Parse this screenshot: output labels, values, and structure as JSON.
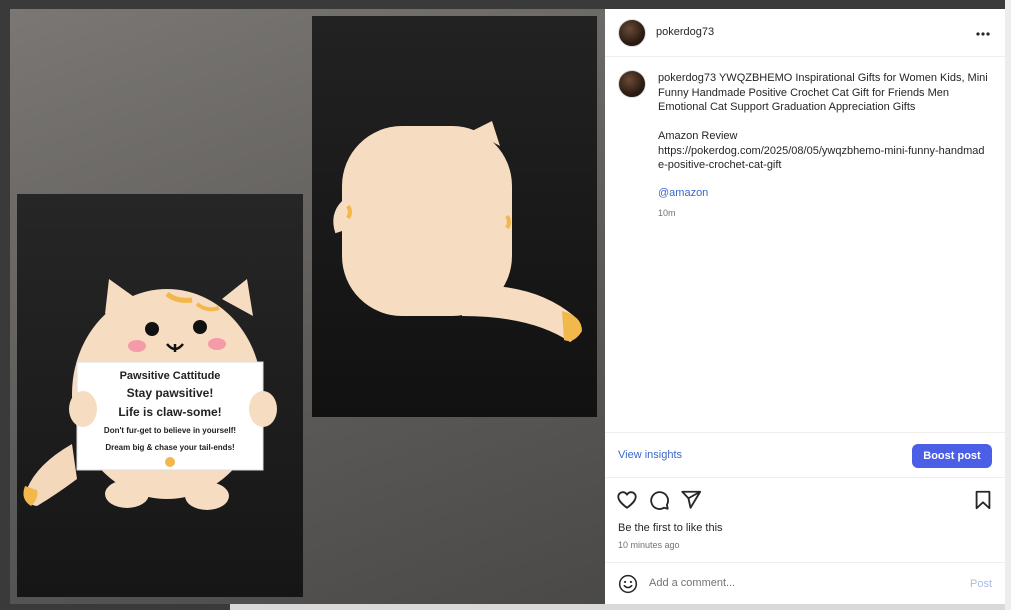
{
  "post": {
    "username": "pokerdog73",
    "more_icon": "more-horizontal-icon",
    "caption_user": "pokerdog73",
    "caption_line1": "YWQZBHEMO Inspirational Gifts for Women Kids, Mini Funny Handmade Positive Crochet Cat Gift for Friends Men Emotional Cat Support Graduation Appreciation Gifts",
    "caption_line2": "Amazon Review",
    "caption_line3": "https://pokerdog.com/2025/08/05/ywqzbhemo-mini-funny-handmade-positive-crochet-cat-gift",
    "mention": "@amazon",
    "caption_time": "10m",
    "view_insights": "View insights",
    "boost_label": "Boost post",
    "likes_text": "Be the first to like this",
    "time_ago": "10 minutes ago",
    "comment_placeholder": "Add a comment...",
    "post_label": "Post"
  },
  "photo_left": {
    "card_title": "Pawsitive Cattitude",
    "card_line1": "Stay pawsitive!",
    "card_line2": "Life is claw-some!",
    "card_line3": "Don't fur-get to believe in yourself!",
    "card_line4": "Dream big & chase your tail-ends!"
  },
  "colors": {
    "accent": "#4a5ee6",
    "link": "#3a67c8",
    "crochet": "#f6dcc0",
    "stripe": "#f2b84b"
  }
}
